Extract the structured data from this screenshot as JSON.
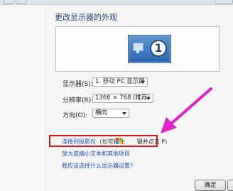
{
  "dialog": {
    "title": "更改显示器的外观",
    "monitor_badge": "1"
  },
  "settings": {
    "display_label": "显示器(S):",
    "display_value": "1. 移动 PC 显示屏",
    "resolution_label": "分辨率(R):",
    "resolution_value": "1366 × 768 (推荐)",
    "orientation_label": "方向(O):",
    "orientation_value": "横向"
  },
  "links": {
    "projector_link": "连接到投影仪",
    "projector_hint_prefix": "(也可按住",
    "projector_hint_suffix": "键并点击 P)",
    "text_size_link": "放大或缩小文本和其他项目",
    "which_settings_link": "我应该选择什么显示器设置?"
  },
  "buttons": {
    "ok_label": "确定"
  },
  "annotation": {
    "highlight_color": "#e0141a",
    "arrow_color": "#e020c8"
  },
  "icons": {
    "windows_logo": "windows-logo-icon",
    "monitor": "monitor-icon"
  }
}
